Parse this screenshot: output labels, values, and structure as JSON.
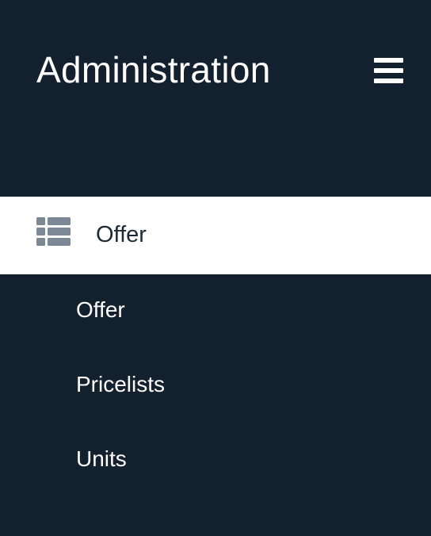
{
  "header": {
    "title": "Administration",
    "menu_icon": "hamburger-menu-icon"
  },
  "nav": {
    "active_section": {
      "label": "Offer",
      "icon": "list-icon"
    },
    "items": [
      {
        "label": "Offer"
      },
      {
        "label": "Pricelists"
      },
      {
        "label": "Units"
      }
    ]
  },
  "colors": {
    "background": "#13202e",
    "active_background": "#ffffff",
    "icon_gray": "#7d8896",
    "active_text": "#1e2a38",
    "text": "#ffffff"
  }
}
